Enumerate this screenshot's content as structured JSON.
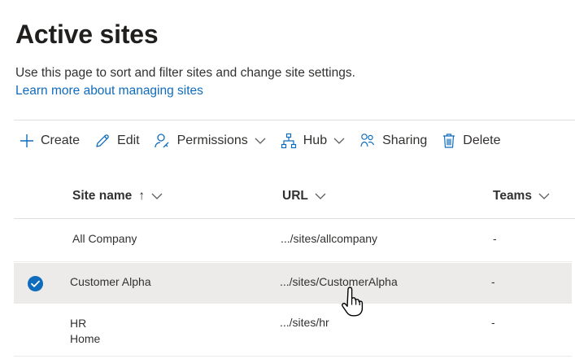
{
  "page": {
    "title": "Active sites",
    "description": "Use this page to sort and filter sites and change site settings.",
    "learn_more": "Learn more about managing sites"
  },
  "toolbar": {
    "create": "Create",
    "edit": "Edit",
    "permissions": "Permissions",
    "hub": "Hub",
    "sharing": "Sharing",
    "delete": "Delete"
  },
  "table": {
    "columns": {
      "site_name": "Site name",
      "site_name_sort": "↑",
      "url": "URL",
      "teams": "Teams"
    },
    "rows": [
      {
        "name": "All Company",
        "name2": "",
        "url": ".../sites/allcompany",
        "teams": "-",
        "selected": false
      },
      {
        "name": "Customer Alpha",
        "name2": "",
        "url": ".../sites/CustomerAlpha",
        "teams": "-",
        "selected": true
      },
      {
        "name": "HR",
        "name2": "Home",
        "url": ".../sites/hr",
        "teams": "-",
        "selected": false
      }
    ]
  },
  "colors": {
    "accent": "#0f6cbd",
    "selected_row": "#edebe9",
    "check": "#0f6cbd"
  }
}
